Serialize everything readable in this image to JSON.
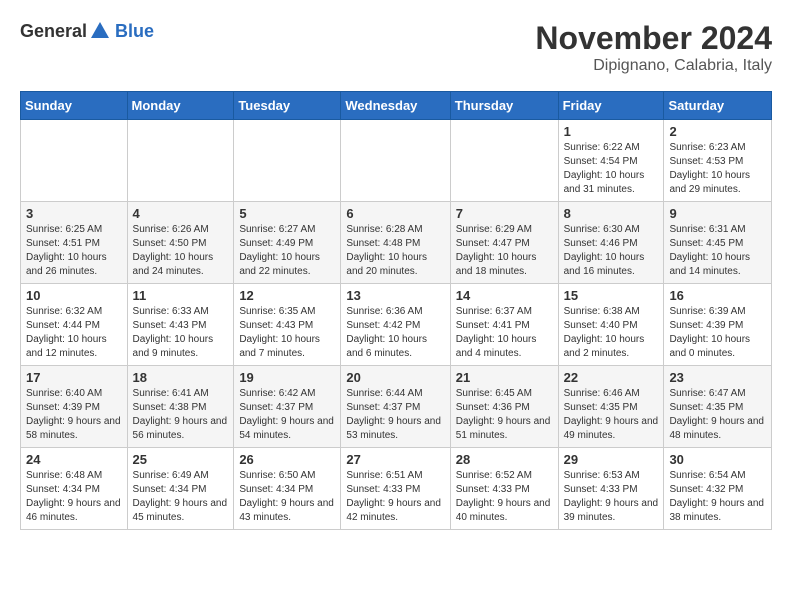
{
  "logo": {
    "general": "General",
    "blue": "Blue"
  },
  "title": "November 2024",
  "location": "Dipignano, Calabria, Italy",
  "headers": [
    "Sunday",
    "Monday",
    "Tuesday",
    "Wednesday",
    "Thursday",
    "Friday",
    "Saturday"
  ],
  "weeks": [
    [
      {
        "day": "",
        "info": ""
      },
      {
        "day": "",
        "info": ""
      },
      {
        "day": "",
        "info": ""
      },
      {
        "day": "",
        "info": ""
      },
      {
        "day": "",
        "info": ""
      },
      {
        "day": "1",
        "info": "Sunrise: 6:22 AM\nSunset: 4:54 PM\nDaylight: 10 hours and 31 minutes."
      },
      {
        "day": "2",
        "info": "Sunrise: 6:23 AM\nSunset: 4:53 PM\nDaylight: 10 hours and 29 minutes."
      }
    ],
    [
      {
        "day": "3",
        "info": "Sunrise: 6:25 AM\nSunset: 4:51 PM\nDaylight: 10 hours and 26 minutes."
      },
      {
        "day": "4",
        "info": "Sunrise: 6:26 AM\nSunset: 4:50 PM\nDaylight: 10 hours and 24 minutes."
      },
      {
        "day": "5",
        "info": "Sunrise: 6:27 AM\nSunset: 4:49 PM\nDaylight: 10 hours and 22 minutes."
      },
      {
        "day": "6",
        "info": "Sunrise: 6:28 AM\nSunset: 4:48 PM\nDaylight: 10 hours and 20 minutes."
      },
      {
        "day": "7",
        "info": "Sunrise: 6:29 AM\nSunset: 4:47 PM\nDaylight: 10 hours and 18 minutes."
      },
      {
        "day": "8",
        "info": "Sunrise: 6:30 AM\nSunset: 4:46 PM\nDaylight: 10 hours and 16 minutes."
      },
      {
        "day": "9",
        "info": "Sunrise: 6:31 AM\nSunset: 4:45 PM\nDaylight: 10 hours and 14 minutes."
      }
    ],
    [
      {
        "day": "10",
        "info": "Sunrise: 6:32 AM\nSunset: 4:44 PM\nDaylight: 10 hours and 12 minutes."
      },
      {
        "day": "11",
        "info": "Sunrise: 6:33 AM\nSunset: 4:43 PM\nDaylight: 10 hours and 9 minutes."
      },
      {
        "day": "12",
        "info": "Sunrise: 6:35 AM\nSunset: 4:43 PM\nDaylight: 10 hours and 7 minutes."
      },
      {
        "day": "13",
        "info": "Sunrise: 6:36 AM\nSunset: 4:42 PM\nDaylight: 10 hours and 6 minutes."
      },
      {
        "day": "14",
        "info": "Sunrise: 6:37 AM\nSunset: 4:41 PM\nDaylight: 10 hours and 4 minutes."
      },
      {
        "day": "15",
        "info": "Sunrise: 6:38 AM\nSunset: 4:40 PM\nDaylight: 10 hours and 2 minutes."
      },
      {
        "day": "16",
        "info": "Sunrise: 6:39 AM\nSunset: 4:39 PM\nDaylight: 10 hours and 0 minutes."
      }
    ],
    [
      {
        "day": "17",
        "info": "Sunrise: 6:40 AM\nSunset: 4:39 PM\nDaylight: 9 hours and 58 minutes."
      },
      {
        "day": "18",
        "info": "Sunrise: 6:41 AM\nSunset: 4:38 PM\nDaylight: 9 hours and 56 minutes."
      },
      {
        "day": "19",
        "info": "Sunrise: 6:42 AM\nSunset: 4:37 PM\nDaylight: 9 hours and 54 minutes."
      },
      {
        "day": "20",
        "info": "Sunrise: 6:44 AM\nSunset: 4:37 PM\nDaylight: 9 hours and 53 minutes."
      },
      {
        "day": "21",
        "info": "Sunrise: 6:45 AM\nSunset: 4:36 PM\nDaylight: 9 hours and 51 minutes."
      },
      {
        "day": "22",
        "info": "Sunrise: 6:46 AM\nSunset: 4:35 PM\nDaylight: 9 hours and 49 minutes."
      },
      {
        "day": "23",
        "info": "Sunrise: 6:47 AM\nSunset: 4:35 PM\nDaylight: 9 hours and 48 minutes."
      }
    ],
    [
      {
        "day": "24",
        "info": "Sunrise: 6:48 AM\nSunset: 4:34 PM\nDaylight: 9 hours and 46 minutes."
      },
      {
        "day": "25",
        "info": "Sunrise: 6:49 AM\nSunset: 4:34 PM\nDaylight: 9 hours and 45 minutes."
      },
      {
        "day": "26",
        "info": "Sunrise: 6:50 AM\nSunset: 4:34 PM\nDaylight: 9 hours and 43 minutes."
      },
      {
        "day": "27",
        "info": "Sunrise: 6:51 AM\nSunset: 4:33 PM\nDaylight: 9 hours and 42 minutes."
      },
      {
        "day": "28",
        "info": "Sunrise: 6:52 AM\nSunset: 4:33 PM\nDaylight: 9 hours and 40 minutes."
      },
      {
        "day": "29",
        "info": "Sunrise: 6:53 AM\nSunset: 4:33 PM\nDaylight: 9 hours and 39 minutes."
      },
      {
        "day": "30",
        "info": "Sunrise: 6:54 AM\nSunset: 4:32 PM\nDaylight: 9 hours and 38 minutes."
      }
    ]
  ]
}
